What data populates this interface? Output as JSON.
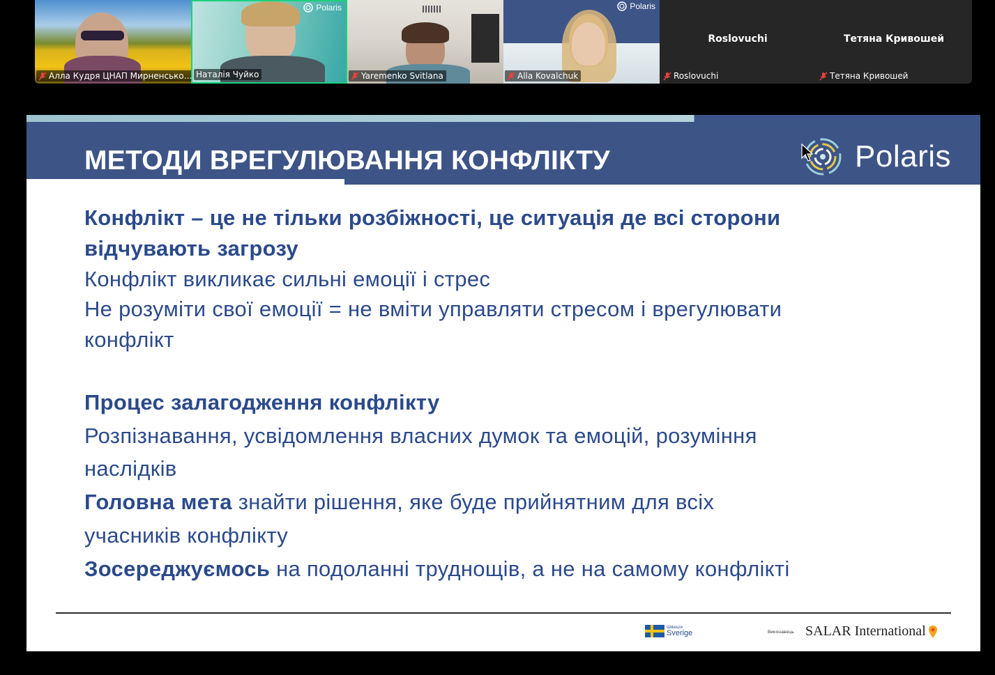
{
  "participants": [
    {
      "name": "Алла Кудря ЦНАП Мирненсько...",
      "muted": true,
      "label": ""
    },
    {
      "name": "Наталія Чуйко",
      "muted": false,
      "active": true,
      "label": ""
    },
    {
      "name": "Yaremenko Svitlana",
      "muted": true,
      "label": ""
    },
    {
      "name": "Alla Kovalchuk",
      "muted": true,
      "label": ""
    },
    {
      "name": "Roslovuchi",
      "muted": true,
      "label": "Roslovuchi"
    },
    {
      "name": "Тетяна Кривошей",
      "muted": true,
      "label": "Тетяна Кривошей"
    }
  ],
  "tile_logo_text": "Polaris",
  "slide": {
    "title": "МЕТОДИ ВРЕГУЛЮВАННЯ КОНФЛІКТУ",
    "logo_text": "Polaris",
    "lines": [
      {
        "bold": "Конфлікт – це не тільки розбіжності, це ситуація де всі сторони",
        "rest": ""
      },
      {
        "bold": "відчувають загрозу",
        "rest": ""
      },
      {
        "bold": "",
        "rest": "Конфлікт викликає сильні емоції і стрес"
      },
      {
        "bold": "",
        "rest": "Не розуміти свої емоції = не вміти управляти стресом і врегулювати"
      },
      {
        "bold": "",
        "rest": "конфлікт"
      },
      {
        "bold": "Процес залагодження конфлікту",
        "rest": ""
      },
      {
        "bold": "",
        "rest": "Розпізнавання, усвідомлення власних думок та емоцій, розуміння"
      },
      {
        "bold": "",
        "rest": "наслідків"
      },
      {
        "bold": "Головна мета",
        "rest": " знайти рішення, яке буде прийнятним для всіх"
      },
      {
        "bold": "",
        "rest": "учасників конфлікту"
      },
      {
        "bold": "Зосереджуємось",
        "rest": " на подоланні труднощів, а не на самому конфлікті"
      }
    ],
    "footer": {
      "sweden_small": "Швеція",
      "sweden_label": "Sverige",
      "partner_small": "Виконавець",
      "salar_text": "SALAR International"
    }
  },
  "colors": {
    "slide_header": "#3d5487",
    "slide_text": "#2b4a8c",
    "active_speaker": "#19d27c",
    "muted_icon": "#e8413c"
  }
}
